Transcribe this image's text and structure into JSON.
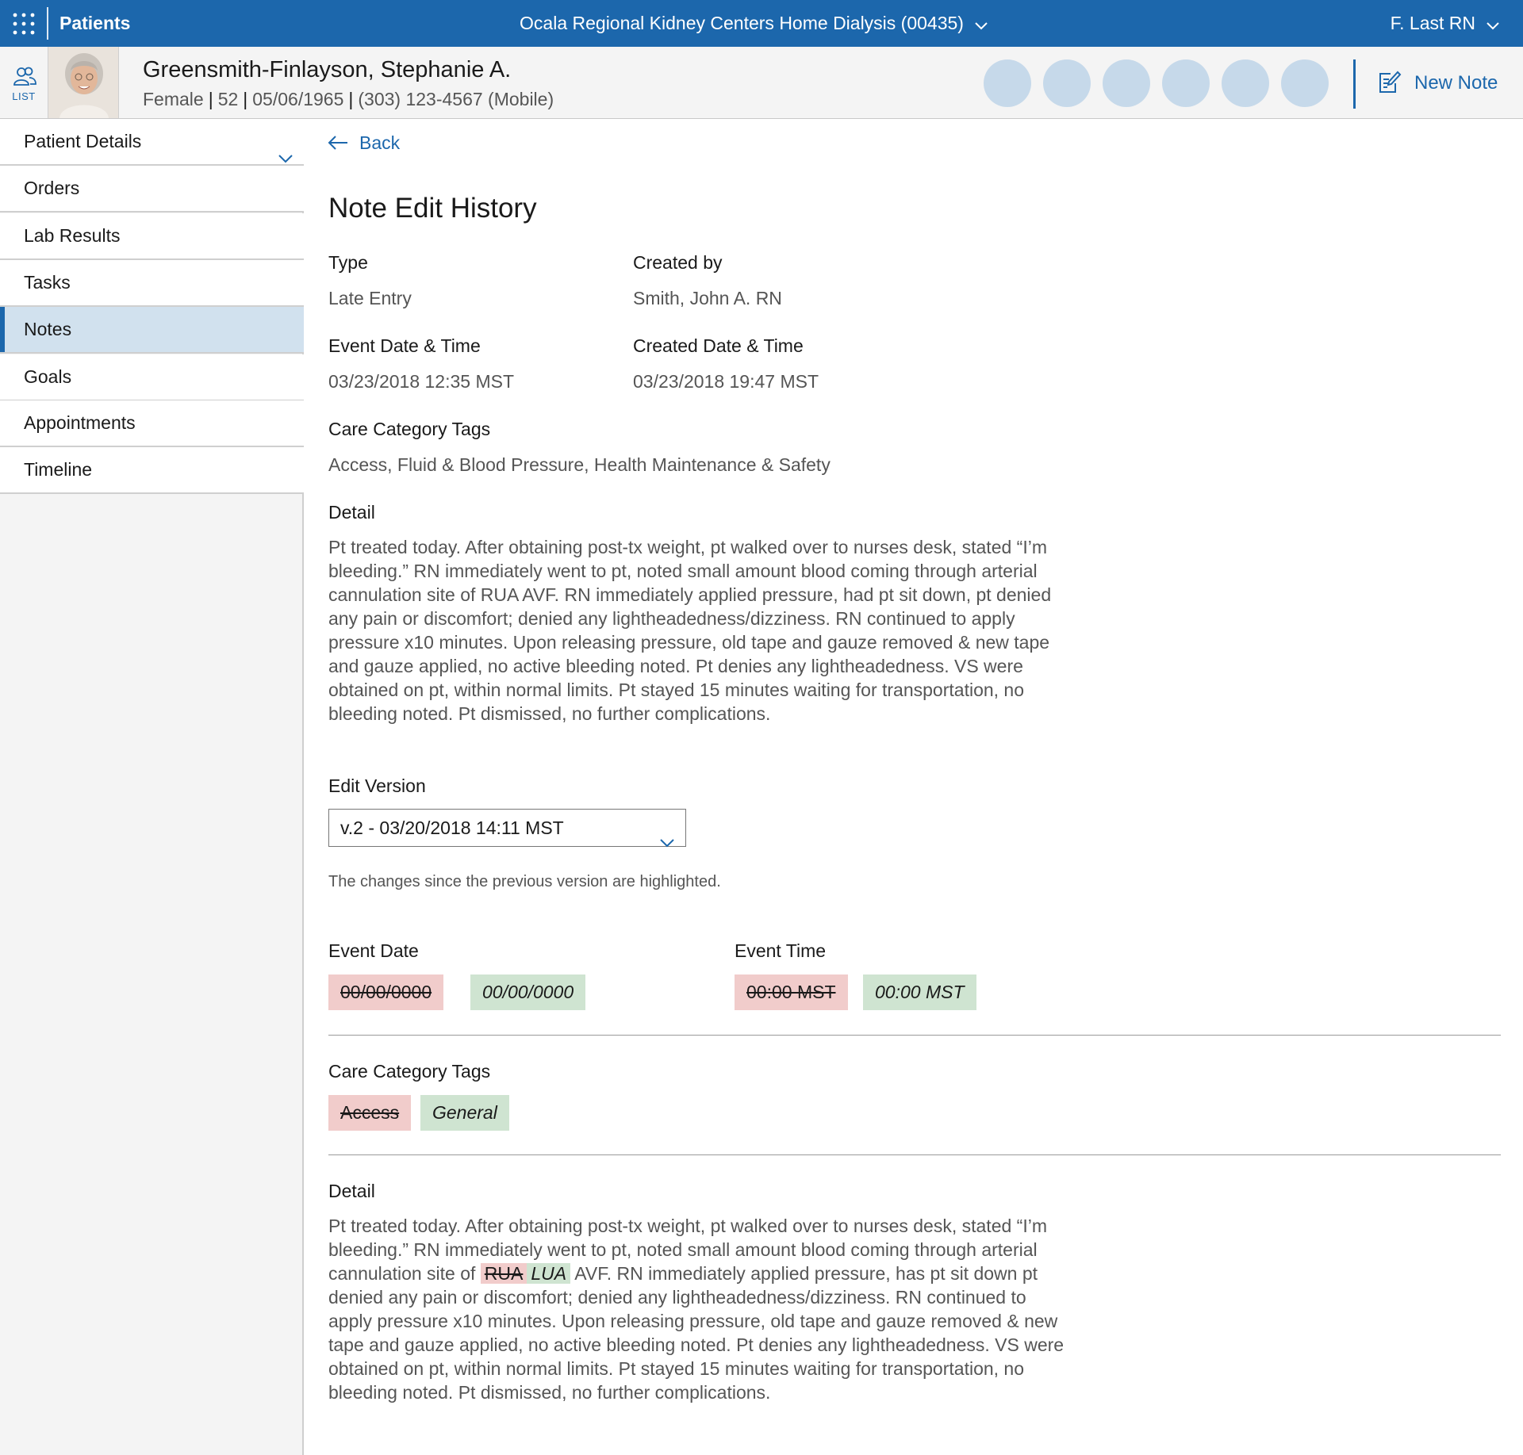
{
  "topbar": {
    "app_title": "Patients",
    "facility": "Ocala Regional Kidney Centers Home Dialysis (00435)",
    "user": "F. Last RN"
  },
  "patient": {
    "list_label": "LIST",
    "name": "Greensmith-Finlayson, Stephanie A.",
    "sex": "Female",
    "age": "52",
    "dob": "05/06/1965",
    "phone": "(303) 123-4567 (Mobile)",
    "new_note_label": "New Note"
  },
  "sidebar": {
    "items": [
      {
        "label": "Patient Details"
      },
      {
        "label": "Orders"
      },
      {
        "label": "Lab Results"
      },
      {
        "label": "Tasks"
      },
      {
        "label": "Notes"
      },
      {
        "label": "Goals"
      },
      {
        "label": "Appointments"
      },
      {
        "label": "Timeline"
      }
    ]
  },
  "main": {
    "back_label": "Back",
    "title": "Note Edit History",
    "type_label": "Type",
    "type_value": "Late Entry",
    "created_by_label": "Created by",
    "created_by_value": "Smith, John A.  RN",
    "event_dt_label": "Event Date & Time",
    "event_dt_value": "03/23/2018  12:35 MST",
    "created_dt_label": "Created Date & Time",
    "created_dt_value": "03/23/2018  19:47 MST",
    "tags_label": "Care Category Tags",
    "tags_value": "Access, Fluid & Blood Pressure, Health Maintenance & Safety",
    "detail_label": "Detail",
    "detail_text": "Pt treated today. After obtaining post-tx weight, pt walked over to nurses desk, stated “I’m bleeding.” RN immediately went to pt, noted small amount blood coming through arterial cannulation site of RUA AVF. RN immediately applied pressure, had pt sit down, pt denied any pain or discomfort; denied any lightheadedness/dizziness. RN continued to apply pressure x10 minutes. Upon releasing pressure, old tape and gauze removed & new tape and gauze applied, no active bleeding noted. Pt denies any lightheadedness. VS were obtained on pt, within normal limits. Pt stayed 15 minutes waiting for transportation, no bleeding noted. Pt dismissed, no further complications."
  },
  "edit": {
    "version_label": "Edit Version",
    "version_selected": "v.2 - 03/20/2018  14:11 MST",
    "hint": "The changes since the previous version are highlighted.",
    "event_date_label": "Event Date",
    "event_date_old": "00/00/0000",
    "event_date_new": "00/00/0000",
    "event_time_label": "Event Time",
    "event_time_old": "00:00 MST",
    "event_time_new": "00:00 MST",
    "tags_label": "Care Category Tags",
    "tag_old": "Access",
    "tag_new": "General",
    "detail_label": "Detail",
    "detail_before": "Pt treated today. After obtaining post-tx weight, pt walked over to nurses desk, stated “I’m bleeding.” RN immediately went to pt, noted small amount blood coming through arterial cannulation site of ",
    "detail_del": "RUA",
    "detail_ins": "LUA",
    "detail_after": " AVF. RN immediately applied pressure, has pt sit down pt denied any pain or discomfort; denied any lightheadedness/dizziness. RN continued to apply pressure x10 minutes. Upon releasing pressure, old tape and gauze removed & new tape and gauze applied, no active bleeding noted. Pt denies any lightheadedness. VS were obtained on pt, within normal limits. Pt stayed 15 minutes waiting for transportation, no bleeding noted. Pt dismissed, no further complications."
  },
  "colors": {
    "brand": "#1c67ac",
    "active_nav": "#d1e1ee",
    "deleted_bg": "#f1cccb",
    "inserted_bg": "#cfe4d1",
    "quick_action_circle": "#c6d9ea"
  },
  "icons": {
    "app_launcher": "grid-icon",
    "list": "users-icon",
    "new_note": "edit-note-icon",
    "back": "arrow-left-icon",
    "dropdown": "chevron-down-icon"
  }
}
